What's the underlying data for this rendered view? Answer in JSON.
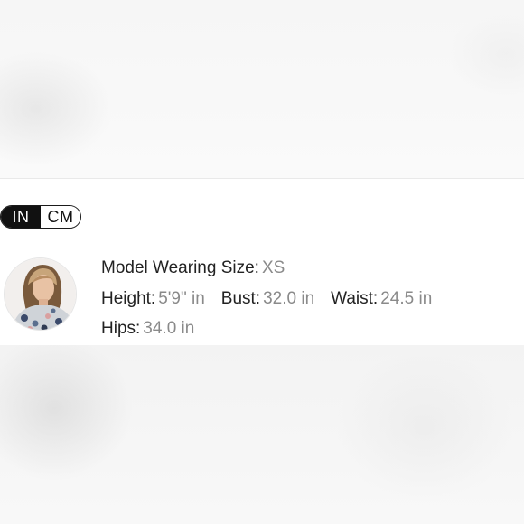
{
  "unit_toggle": {
    "options": [
      "IN",
      "CM"
    ],
    "selected": "IN"
  },
  "model": {
    "avatar_icon": "model-photo",
    "size": {
      "label": "Model Wearing Size:",
      "value": "XS"
    },
    "height": {
      "label": "Height:",
      "value": "5'9\" in"
    },
    "bust": {
      "label": "Bust:",
      "value": "32.0 in"
    },
    "waist": {
      "label": "Waist:",
      "value": "24.5 in"
    },
    "hips": {
      "label": "Hips:",
      "value": "34.0 in"
    }
  },
  "colors": {
    "toggle_active_bg": "#111111",
    "label": "#222222",
    "value": "#8a8a8a"
  }
}
